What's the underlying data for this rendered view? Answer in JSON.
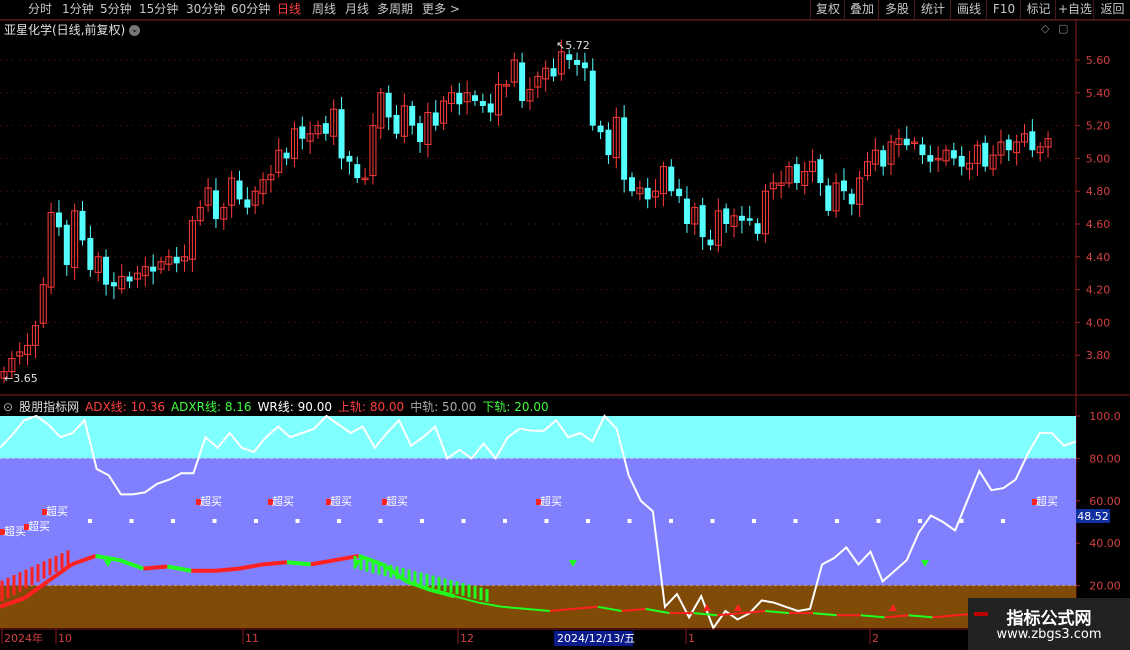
{
  "toolbar": {
    "periods": [
      "分时",
      "1分钟",
      "5分钟",
      "15分钟",
      "30分钟",
      "60分钟",
      "日线",
      "周线",
      "月线",
      "多周期",
      "更多 >"
    ],
    "active_period": "日线",
    "right_buttons": [
      "复权",
      "叠加",
      "多股",
      "统计",
      "画线",
      "F10",
      "标记",
      "+自选",
      "返回"
    ]
  },
  "kline": {
    "title": "亚星化学(日线,前复权)",
    "dropdown_icon": "chevron-down-icon",
    "high_label": "5.72",
    "low_label": "3.65",
    "price_ticks": [
      "5.60",
      "5.40",
      "5.20",
      "5.00",
      "4.80",
      "4.60",
      "4.40",
      "4.20",
      "4.00",
      "3.80"
    ]
  },
  "indicator": {
    "name": "股朋指标网",
    "adx_label": "ADX线: 10.36",
    "adxr_label": "ADXR线: 8.16",
    "wr_label": "WR线: 90.00",
    "upper_label": "上轨: 80.00",
    "middle_label": "中轨: 50.00",
    "lower_label": "下轨: 20.00",
    "ticks": [
      "100.0",
      "80.00",
      "60.00",
      "40.00",
      "20.00"
    ],
    "current_value": "48.52",
    "signal_text": "超买"
  },
  "time_axis": {
    "labels": [
      "2024年",
      "10",
      "11",
      "12",
      "1",
      "2"
    ],
    "cursor_date": "2024/12/13/五"
  },
  "colors": {
    "up": "#ff3a3a",
    "down": "#54ffff",
    "top_band": "#80ffff",
    "mid_band": "#8080ff",
    "bottom_band": "#7f4b07"
  },
  "watermark": {
    "title": "指标公式网",
    "url": "www.zbgs3.com"
  }
}
